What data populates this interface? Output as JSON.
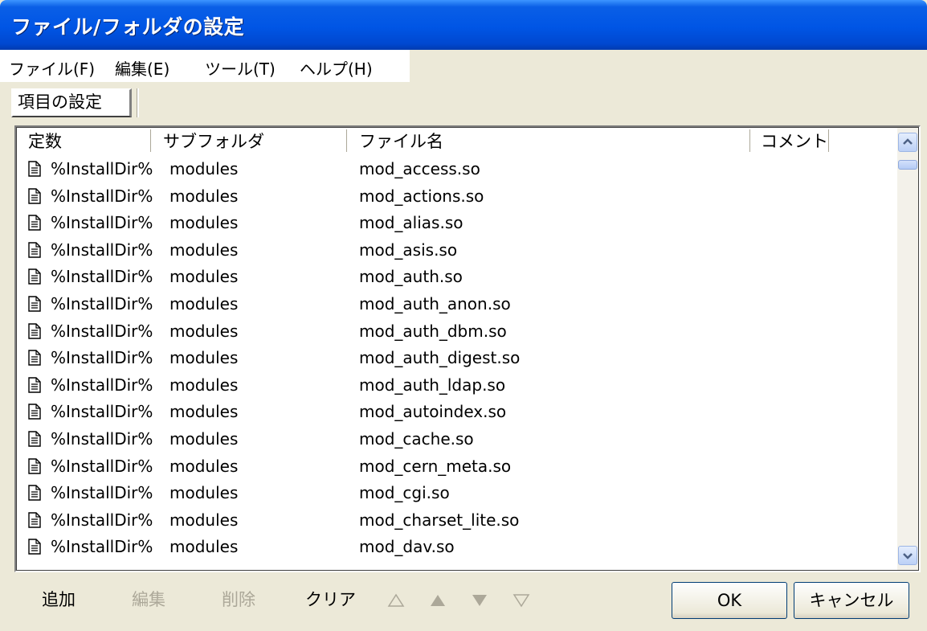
{
  "window": {
    "title": "ファイル/フォルダの設定"
  },
  "menu": [
    "ファイル(F)",
    "編集(E)",
    "ツール(T)",
    "ヘルプ(H)"
  ],
  "tabs": [
    "項目の設定"
  ],
  "list": {
    "columns": [
      "定数",
      "サブフォルダ",
      "ファイル名",
      "コメント"
    ],
    "rows": [
      {
        "const": "%InstallDir%",
        "subfolder": "modules",
        "file": "mod_access.so",
        "comment": ""
      },
      {
        "const": "%InstallDir%",
        "subfolder": "modules",
        "file": "mod_actions.so",
        "comment": ""
      },
      {
        "const": "%InstallDir%",
        "subfolder": "modules",
        "file": "mod_alias.so",
        "comment": ""
      },
      {
        "const": "%InstallDir%",
        "subfolder": "modules",
        "file": "mod_asis.so",
        "comment": ""
      },
      {
        "const": "%InstallDir%",
        "subfolder": "modules",
        "file": "mod_auth.so",
        "comment": ""
      },
      {
        "const": "%InstallDir%",
        "subfolder": "modules",
        "file": "mod_auth_anon.so",
        "comment": ""
      },
      {
        "const": "%InstallDir%",
        "subfolder": "modules",
        "file": "mod_auth_dbm.so",
        "comment": ""
      },
      {
        "const": "%InstallDir%",
        "subfolder": "modules",
        "file": "mod_auth_digest.so",
        "comment": ""
      },
      {
        "const": "%InstallDir%",
        "subfolder": "modules",
        "file": "mod_auth_ldap.so",
        "comment": ""
      },
      {
        "const": "%InstallDir%",
        "subfolder": "modules",
        "file": "mod_autoindex.so",
        "comment": ""
      },
      {
        "const": "%InstallDir%",
        "subfolder": "modules",
        "file": "mod_cache.so",
        "comment": ""
      },
      {
        "const": "%InstallDir%",
        "subfolder": "modules",
        "file": "mod_cern_meta.so",
        "comment": ""
      },
      {
        "const": "%InstallDir%",
        "subfolder": "modules",
        "file": "mod_cgi.so",
        "comment": ""
      },
      {
        "const": "%InstallDir%",
        "subfolder": "modules",
        "file": "mod_charset_lite.so",
        "comment": ""
      },
      {
        "const": "%InstallDir%",
        "subfolder": "modules",
        "file": "mod_dav.so",
        "comment": ""
      }
    ]
  },
  "icons": {
    "row": "file-document-icon",
    "scroll_up": "scroll-up-arrow-icon",
    "scroll_down": "scroll-down-arrow-icon",
    "move_top": "move-top-icon",
    "move_up": "move-up-icon",
    "move_down": "move-down-icon",
    "move_bottom": "move-bottom-icon"
  },
  "toolbar": {
    "add": "追加",
    "edit": "編集",
    "delete": "削除",
    "clear": "クリア",
    "ok": "OK",
    "cancel": "キャンセル"
  },
  "colors": {
    "titlebar": "#0055e5",
    "face": "#ece9d8",
    "disabled_text": "#aca899"
  }
}
